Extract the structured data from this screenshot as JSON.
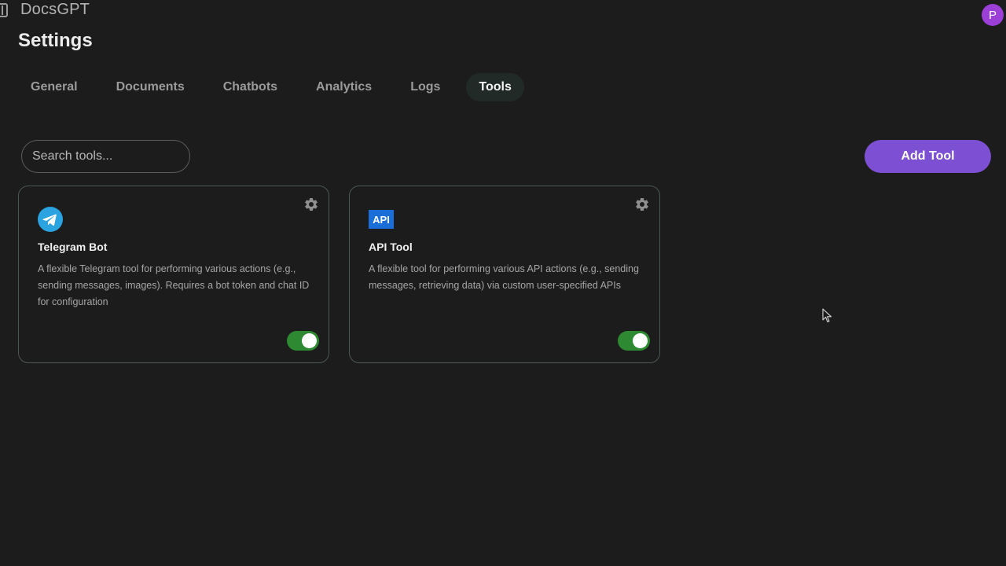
{
  "app": {
    "name": "DocsGPT",
    "avatar_initial": "P"
  },
  "page": {
    "title": "Settings"
  },
  "tabs": [
    {
      "label": "General",
      "active": false
    },
    {
      "label": "Documents",
      "active": false
    },
    {
      "label": "Chatbots",
      "active": false
    },
    {
      "label": "Analytics",
      "active": false
    },
    {
      "label": "Logs",
      "active": false
    },
    {
      "label": "Tools",
      "active": true
    }
  ],
  "search": {
    "placeholder": "Search tools...",
    "value": ""
  },
  "add_tool": {
    "label": "Add Tool"
  },
  "tools": [
    {
      "icon": "telegram-icon",
      "title": "Telegram Bot",
      "description": "A flexible Telegram tool for performing various actions (e.g., sending messages, images). Requires a bot token and chat ID for configuration",
      "enabled": true
    },
    {
      "icon": "api-icon",
      "icon_text": "API",
      "title": "API Tool",
      "description": "A flexible tool for performing various API actions (e.g., sending messages, retrieving data) via custom user-specified APIs",
      "enabled": true
    }
  ],
  "colors": {
    "background": "#1c1c1c",
    "accent": "#7d4fd2",
    "toggle_on": "#2e8a32",
    "avatar": "#9b3fd6"
  }
}
